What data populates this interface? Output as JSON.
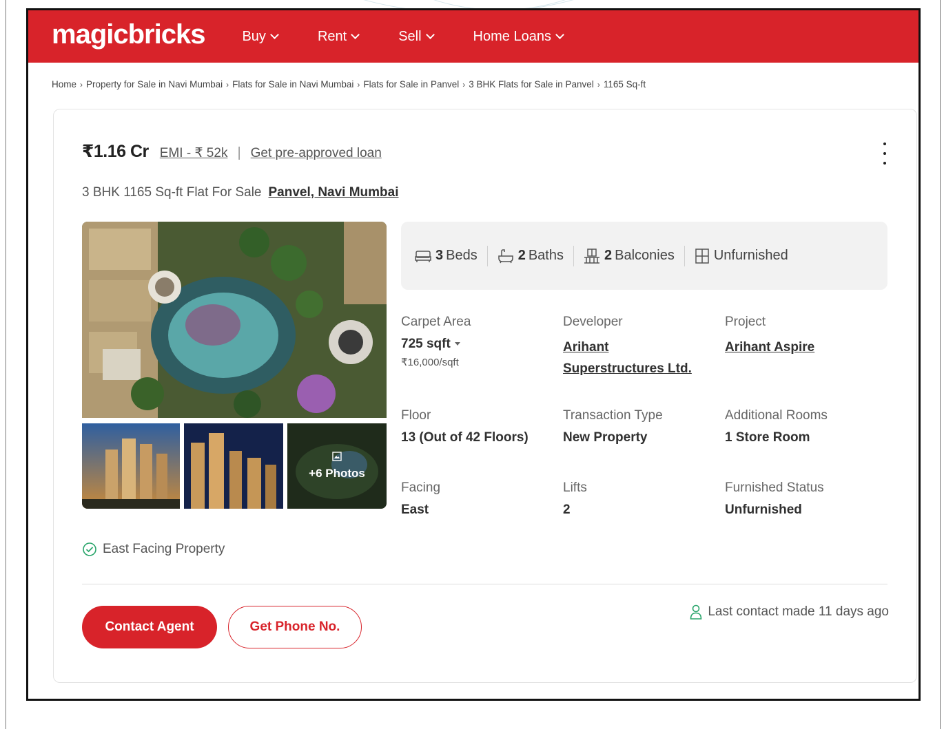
{
  "navbar": {
    "logo": "magicbricks",
    "items": [
      {
        "label": "Buy"
      },
      {
        "label": "Rent"
      },
      {
        "label": "Sell"
      },
      {
        "label": "Home Loans"
      }
    ]
  },
  "breadcrumb": [
    "Home",
    "Property for Sale in Navi Mumbai",
    "Flats for Sale in Navi Mumbai",
    "Flats for Sale in Panvel",
    "3 BHK Flats for Sale in Panvel",
    "1165 Sq-ft"
  ],
  "listing": {
    "price": "₹1.16 Cr",
    "emi": "EMI - ₹ 52k",
    "loan_link": "Get pre-approved loan",
    "title": "3 BHK 1165 Sq-ft Flat For Sale",
    "location": "Panvel, Navi Mumbai",
    "photos_more": "+6 Photos"
  },
  "amenities": {
    "beds": {
      "count": "3",
      "label": "Beds"
    },
    "baths": {
      "count": "2",
      "label": "Baths"
    },
    "balconies": {
      "count": "2",
      "label": "Balconies"
    },
    "furnishing": {
      "label": "Unfurnished"
    }
  },
  "specs": {
    "carpet_area": {
      "label": "Carpet Area",
      "value": "725 sqft",
      "sub": "₹16,000/sqft"
    },
    "developer": {
      "label": "Developer",
      "value": "Arihant Superstructures Ltd."
    },
    "project": {
      "label": "Project",
      "value": "Arihant Aspire"
    },
    "floor": {
      "label": "Floor",
      "value": "13 (Out of 42 Floors)"
    },
    "transaction": {
      "label": "Transaction Type",
      "value": "New Property"
    },
    "additional_rooms": {
      "label": "Additional Rooms",
      "value": "1 Store Room"
    },
    "facing": {
      "label": "Facing",
      "value": "East"
    },
    "lifts": {
      "label": "Lifts",
      "value": "2"
    },
    "furnished_status": {
      "label": "Furnished Status",
      "value": "Unfurnished"
    }
  },
  "feature": "East Facing Property",
  "actions": {
    "contact_agent": "Contact Agent",
    "get_phone": "Get Phone No.",
    "last_contact": "Last contact made 11 days ago"
  },
  "colors": {
    "brand_red": "#d8232a",
    "check_green": "#2aa56b"
  },
  "icons": {
    "bed": "bed-icon",
    "bath": "bathtub-icon",
    "balcony": "balcony-icon",
    "furnishing": "door-icon",
    "check": "check-circle-icon",
    "user": "user-icon",
    "gallery": "image-icon",
    "menu": "kebab-menu-icon"
  }
}
